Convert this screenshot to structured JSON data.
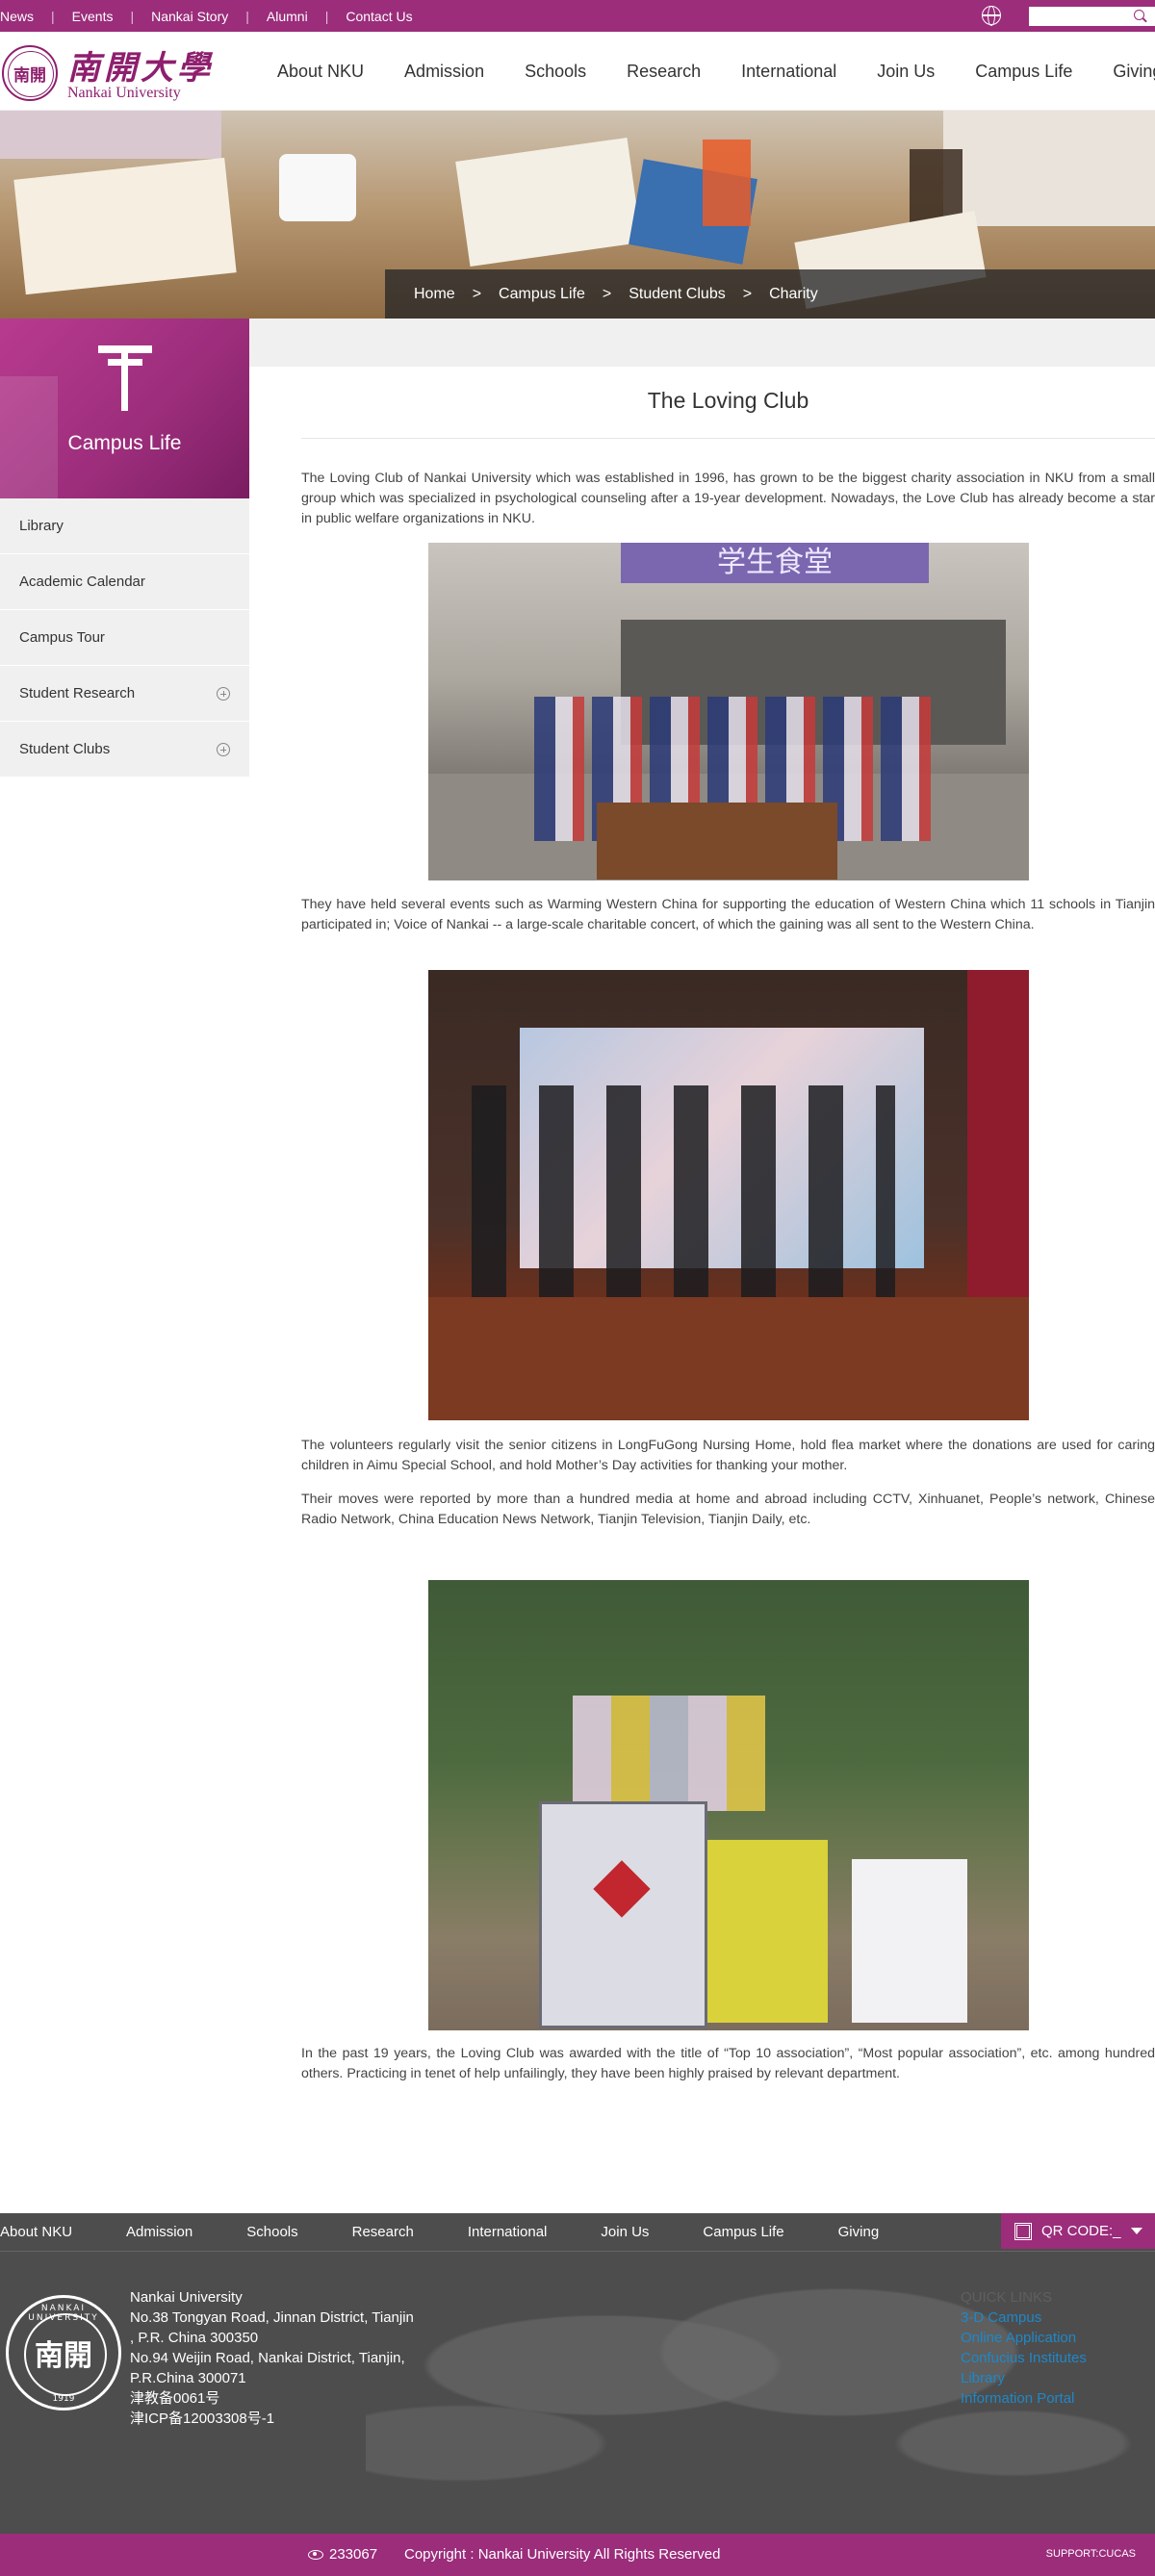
{
  "topbar": {
    "links": [
      "News",
      "Events",
      "Nankai Story",
      "Alumni",
      "Contact Us"
    ],
    "search_placeholder": ""
  },
  "header": {
    "logo_cn": "南開大學",
    "logo_en": "Nankai University",
    "seal_text": "南開",
    "nav": [
      "About NKU",
      "Admission",
      "Schools",
      "Research",
      "International",
      "Join Us",
      "Campus Life",
      "Giving"
    ]
  },
  "breadcrumb": [
    "Home",
    "Campus Life",
    "Student Clubs",
    "Charity"
  ],
  "breadcrumb_sep": ">",
  "sidebar": {
    "title": "Campus Life",
    "items": [
      {
        "label": "Library",
        "expandable": false
      },
      {
        "label": "Academic Calendar",
        "expandable": false
      },
      {
        "label": "Campus Tour",
        "expandable": false
      },
      {
        "label": "Student Research",
        "expandable": true
      },
      {
        "label": "Student Clubs",
        "expandable": true
      }
    ]
  },
  "article": {
    "title": "The Loving Club",
    "paragraphs": [
      "The Loving Club of Nankai University which was established in 1996, has grown to be the biggest charity association in NKU from a small group which was specialized in psychological counseling after a 19-year development. Nowadays, the Love Club has already become a star in public welfare organizations in NKU.",
      "They have held several events such as Warming Western China for supporting the education of Western China which 11 schools in Tianjin participated in; Voice of Nankai -- a large-scale charitable concert, of which the gaining was all sent to the Western China.",
      "The volunteers regularly visit the senior citizens in LongFuGong Nursing Home, hold flea market where the donations are used for caring children in Aimu Special School, and hold Mother’s Day activities for thanking your mother.",
      "Their moves were reported by more than a hundred media at home and abroad including CCTV, Xinhuanet, People’s network, Chinese Radio Network, China Education News Network, Tianjin Television, Tianjin Daily, etc.",
      "In the past 19 years, the Loving Club was awarded with the title of “Top 10 association”, “Most popular association”, etc. among hundred others. Practicing in tenet of help unfailingly, they have been highly praised by relevant department."
    ],
    "photo1_sign": "学生食堂"
  },
  "footer": {
    "nav": [
      "About NKU",
      "Admission",
      "Schools",
      "Research",
      "International",
      "Join Us",
      "Campus Life",
      "Giving"
    ],
    "qr_label": "QR CODE:_",
    "seal_ring": "NANKAI UNIVERSITY",
    "seal_year": "1919",
    "seal_text": "南開",
    "address": [
      "Nankai University",
      "No.38 Tongyan Road, Jinnan District, Tianjin",
      ", P.R. China 300350",
      "No.94 Weijin Road,  Nankai District, Tianjin,",
      "P.R.China  300071",
      "津教备0061号",
      "津ICP备12003308号-1"
    ],
    "quick_links_title": "QUICK LINKS",
    "quick_links": [
      "3-D Campus",
      "Online Application",
      "Confucius Institutes",
      "Library",
      "Information Portal"
    ],
    "visits": "233067",
    "copyright": "Copyright : Nankai University All Rights Reserved",
    "support": "SUPPORT:CUCAS"
  },
  "colors": {
    "brand": "#9b2d7b",
    "footer": "#4d4d4d",
    "link": "#1e88c8"
  }
}
